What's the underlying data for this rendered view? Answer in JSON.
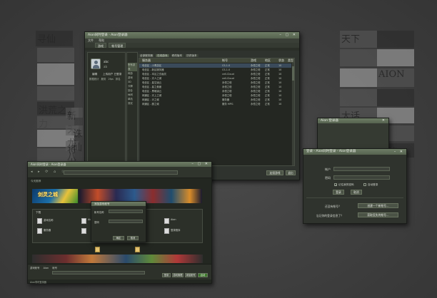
{
  "background": {
    "left_tiles": [
      "寻仙",
      "",
      "",
      "",
      "洪荒之力",
      "",
      "",
      "",
      "新天龙八部",
      "",
      "将太",
      "",
      "诛仙"
    ],
    "right_tiles": [
      "天下",
      "",
      "",
      "",
      "",
      "AION",
      "",
      "",
      "大话",
      "",
      "",
      "封神"
    ]
  },
  "main_window": {
    "title": "Aion同时登录 · Aion登录器",
    "menu": [
      "文件",
      "帮助"
    ],
    "tabs": [
      "游戏",
      "帐号管理"
    ],
    "user": {
      "name": "abc",
      "tag": "ab",
      "avatar_label": "头像"
    },
    "user_actions": [
      "编辑",
      "上传用户 已登录"
    ],
    "nav_labels": [
      "数据统计",
      "服务",
      "2fps",
      "排名"
    ],
    "left_list": [
      "所有游戏",
      "网游",
      "游戏",
      "3D",
      "卡牌",
      "回合",
      "休闲",
      "单机",
      "测试"
    ],
    "subtabs": [
      "全部服务器",
      "在线游戏",
      "修改版本",
      "历史版本"
    ],
    "columns": [
      "服务器",
      "帐号",
      "游戏",
      "地区",
      "状态",
      "类型"
    ],
    "rows": [
      [
        "电信区 - 小黑游区",
        "CS-1.0",
        "永恒之塔",
        "正常",
        "10"
      ],
      [
        "电信区 - 新区服务器",
        "CS-1.0",
        "永恒之塔",
        "正常",
        "10"
      ],
      [
        "电信区 - 本区之玄幽灵",
        "cell-Cloud",
        "永恒之塔",
        "正常",
        "10"
      ],
      [
        "电信区 - 天人之城",
        "cell-Cloud",
        "永恒之塔",
        "正常",
        "10"
      ],
      [
        "电信区 - 星空凌云",
        "永恒之塔",
        "永恒之塔",
        "正常",
        "10"
      ],
      [
        "电信区 - 星之悬崖",
        "永恒之塔",
        "永恒之塔",
        "正常",
        "10"
      ],
      [
        "电信区 - 黑暗凌云",
        "永恒之塔",
        "永恒之塔",
        "正常",
        "10"
      ],
      [
        "网通区 - 天上之城",
        "永恒之塔",
        "永恒之塔",
        "正常",
        "10"
      ],
      [
        "网通区 - 天之城",
        "服务器",
        "永恒之塔",
        "正常",
        "10"
      ],
      [
        "网通区 - 魔之城",
        "服务 MPG",
        "永恒之塔",
        "正常",
        "10"
      ]
    ],
    "footer_buttons": [
      "连接游戏",
      "退出"
    ]
  },
  "login_window": {
    "title": "登录 - Aion同时登录 - Aion登录器",
    "account_label": "帐户",
    "password_label": "密码",
    "remember_label": "记住我的密码",
    "auto_login_label": "自动登录",
    "login_button": "登录",
    "cancel_button": "取消",
    "no_account_prompt": "还没有帐号？",
    "create_button": "创建一个新帐号...",
    "forgot_prompt": "忘记你的登录信息了？",
    "recover_button": "获取丢失的帐号..."
  },
  "behind_window": {
    "title": "Aion 登录器"
  },
  "ui_window": {
    "title": "Aion同时登录 · Aion登录器",
    "top_label": "今天推荐",
    "game_title": "剑灵之城",
    "section_title": "下载",
    "items": [
      "游戏名称",
      "服务器",
      "Aion",
      "Aion",
      "登录程序",
      "Aion"
    ],
    "dialog": {
      "title": "添加游戏帐号",
      "account_label": "帐号名称",
      "password_label": "密码",
      "ok": "确定",
      "cancel": "取消"
    },
    "bottom_tabs": [
      "游戏帐号",
      "Aion",
      "帐号"
    ],
    "bottom_buttons": [
      "登录",
      "游戏管理",
      "添加帐号",
      "启动"
    ],
    "status": "Aion同时登录器"
  },
  "colors": {
    "titlebar": "#5f6d57",
    "panel": "#262924",
    "accent": "#6d7c65",
    "highlight": "#3f6f9f"
  }
}
